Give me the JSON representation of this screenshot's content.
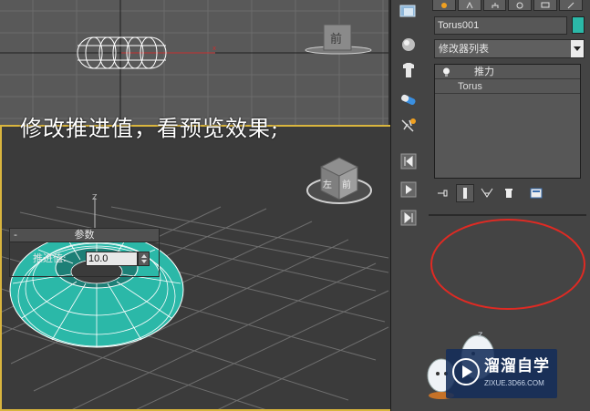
{
  "caption": "修改推进值，看预览效果;",
  "viewports": {
    "top": {
      "view_cube_label": "前"
    },
    "perspective": {
      "view_cube_labels": [
        "左",
        "前"
      ],
      "axis_label": "Z"
    }
  },
  "command_panel": {
    "tabs": [
      "create-tab",
      "modify-tab",
      "hierarchy-tab",
      "motion-tab",
      "display-tab",
      "utilities-tab"
    ],
    "object_name": "Torus001",
    "object_color": "#2bb8a8",
    "modifier_list_label": "修改器列表",
    "stack": {
      "modifier": "推力",
      "base_object": "Torus"
    },
    "rollout": {
      "title": "参数",
      "collapse_symbol": "-",
      "param_label": "推进值:",
      "param_value": "10.0"
    }
  },
  "watermark": {
    "brand": "溜溜自学",
    "url": "ZIXUE.3D66.COM"
  },
  "colors": {
    "accent_viewport_border": "#d9b53e",
    "torus": "#2bb8a8",
    "annotation": "#e02a23"
  }
}
